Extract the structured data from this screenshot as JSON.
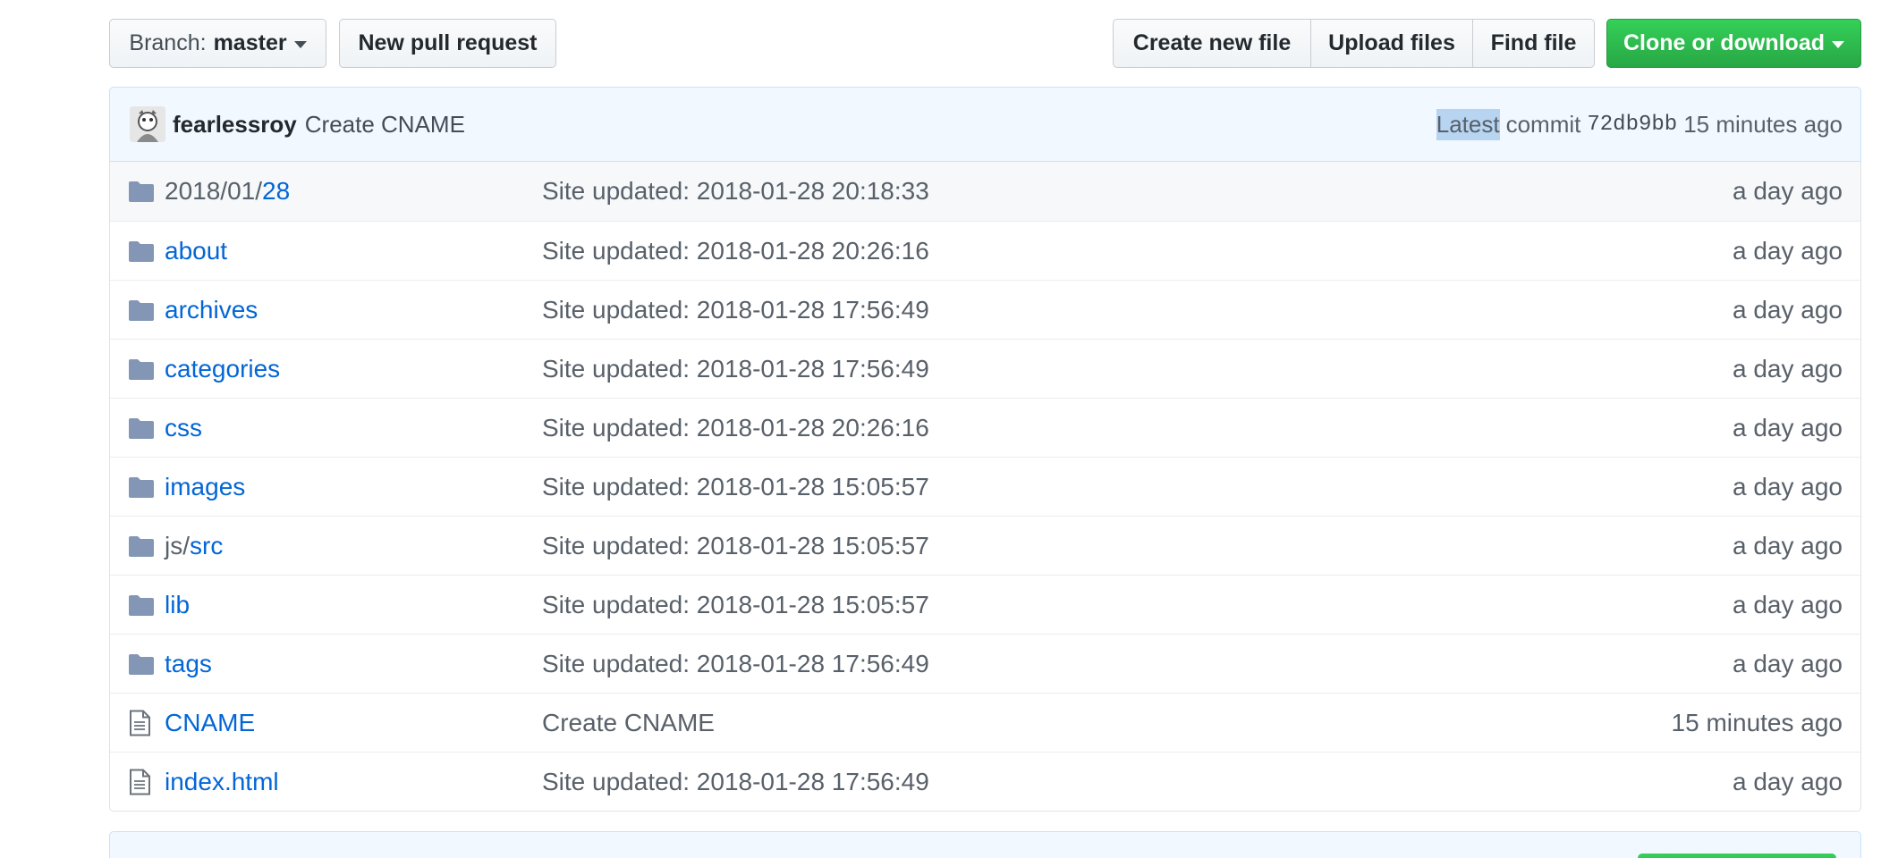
{
  "toolbar": {
    "branch_prefix": "Branch:",
    "branch_name": "master",
    "new_pr_label": "New pull request",
    "create_file_label": "Create new file",
    "upload_files_label": "Upload files",
    "find_file_label": "Find file",
    "clone_label": "Clone or download",
    "clone_color": "#2ea44f"
  },
  "commit": {
    "author": "fearlessroy",
    "message": "Create CNAME",
    "latest_label": "Latest",
    "commit_word": "commit",
    "sha": "72db9bb",
    "time": "15 minutes ago"
  },
  "files": [
    {
      "type": "folder",
      "name_prefix": "2018/01/",
      "name": "28",
      "message": "Site updated: 2018-01-28 20:18:33",
      "age": "a day ago"
    },
    {
      "type": "folder",
      "name_prefix": "",
      "name": "about",
      "message": "Site updated: 2018-01-28 20:26:16",
      "age": "a day ago"
    },
    {
      "type": "folder",
      "name_prefix": "",
      "name": "archives",
      "message": "Site updated: 2018-01-28 17:56:49",
      "age": "a day ago"
    },
    {
      "type": "folder",
      "name_prefix": "",
      "name": "categories",
      "message": "Site updated: 2018-01-28 17:56:49",
      "age": "a day ago"
    },
    {
      "type": "folder",
      "name_prefix": "",
      "name": "css",
      "message": "Site updated: 2018-01-28 20:26:16",
      "age": "a day ago"
    },
    {
      "type": "folder",
      "name_prefix": "",
      "name": "images",
      "message": "Site updated: 2018-01-28 15:05:57",
      "age": "a day ago"
    },
    {
      "type": "folder",
      "name_prefix": "js/",
      "name": "src",
      "message": "Site updated: 2018-01-28 15:05:57",
      "age": "a day ago"
    },
    {
      "type": "folder",
      "name_prefix": "",
      "name": "lib",
      "message": "Site updated: 2018-01-28 15:05:57",
      "age": "a day ago"
    },
    {
      "type": "folder",
      "name_prefix": "",
      "name": "tags",
      "message": "Site updated: 2018-01-28 17:56:49",
      "age": "a day ago"
    },
    {
      "type": "file",
      "name_prefix": "",
      "name": "CNAME",
      "message": "Create CNAME",
      "age": "15 minutes ago"
    },
    {
      "type": "file",
      "name_prefix": "",
      "name": "index.html",
      "message": "Site updated: 2018-01-28 17:56:49",
      "age": "a day ago"
    }
  ],
  "colors": {
    "link": "#0366d6",
    "folder_icon": "#79b8ff",
    "commit_bar_bg": "#f1f8ff"
  }
}
